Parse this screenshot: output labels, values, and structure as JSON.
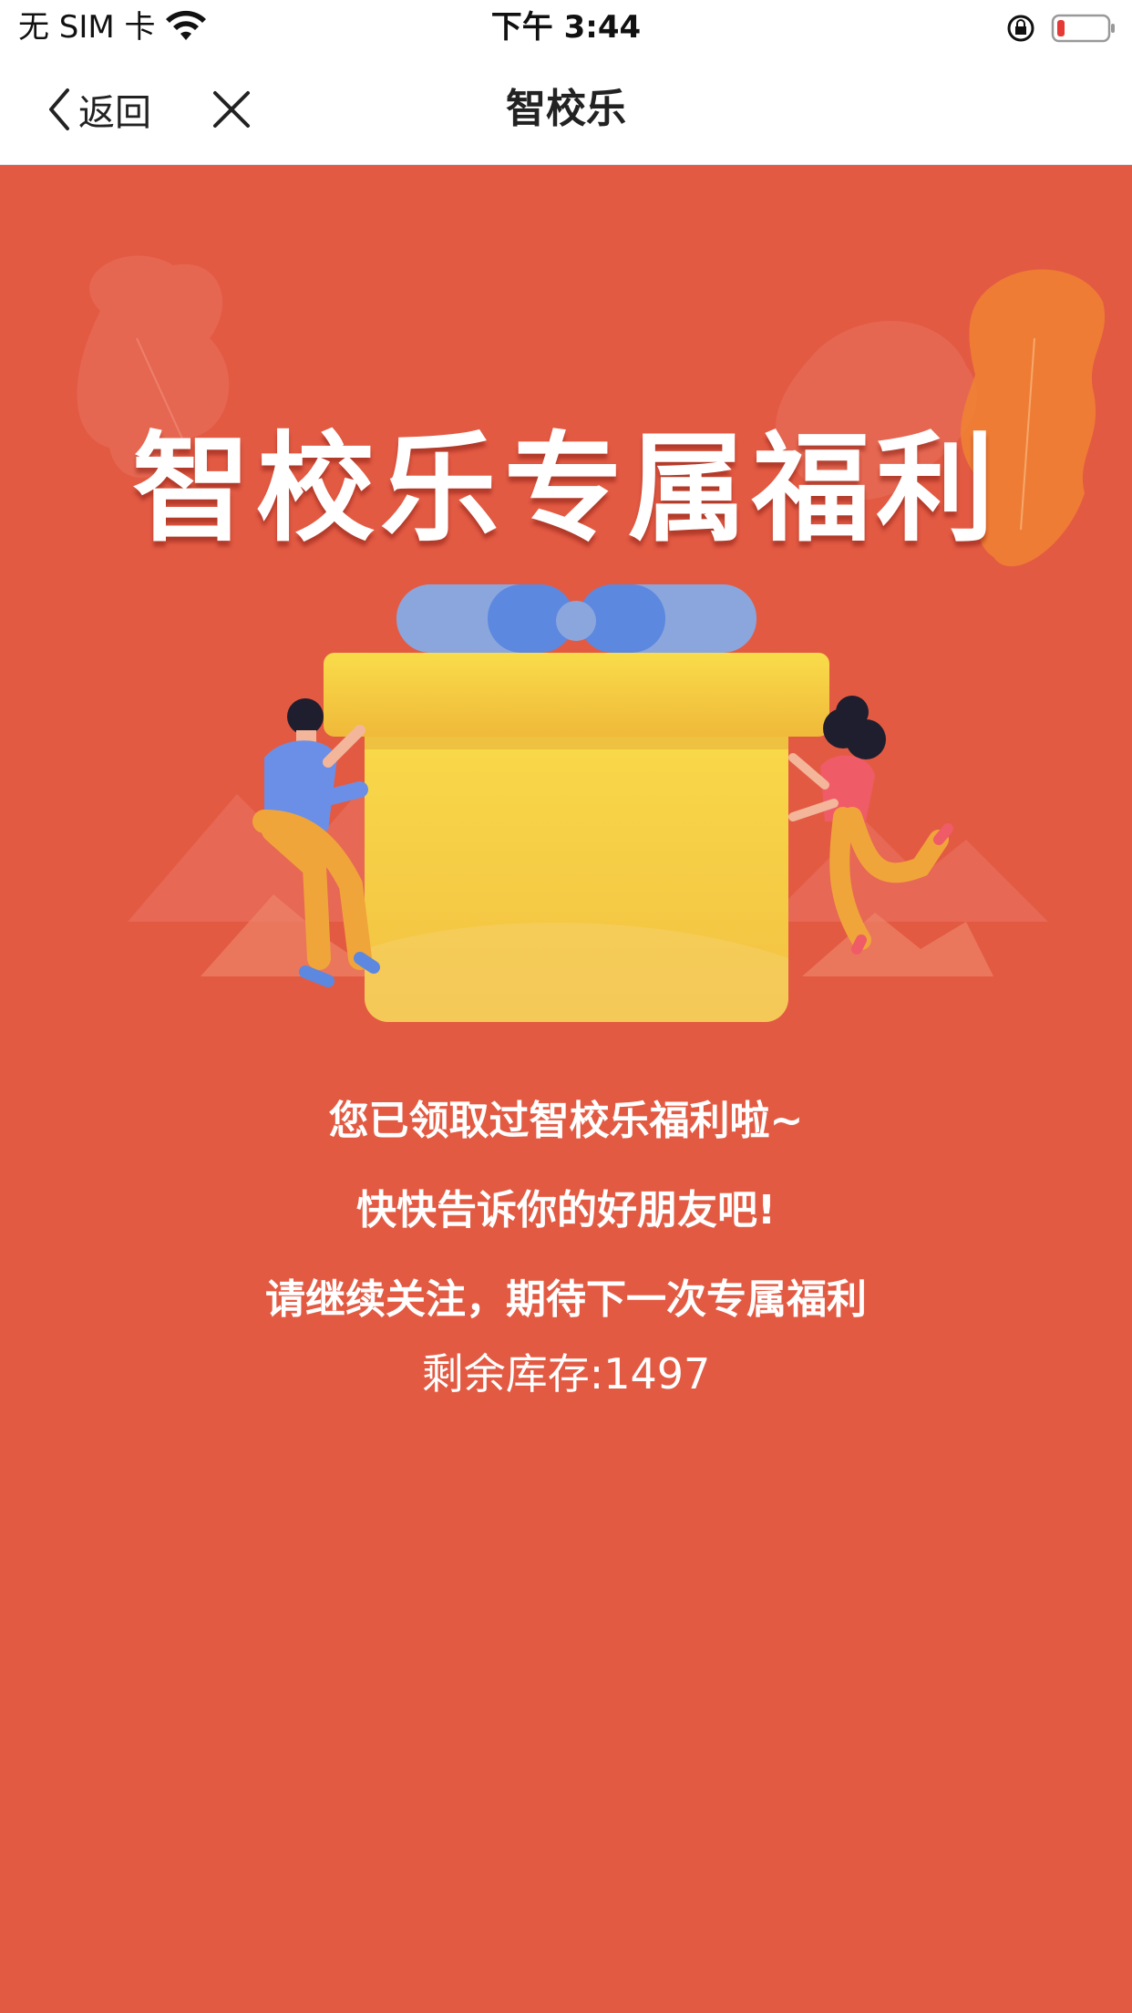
{
  "status_bar": {
    "carrier": "无 SIM 卡",
    "time": "下午 3:44",
    "icons": [
      "wifi-icon",
      "orientation-lock-icon",
      "battery-icon"
    ],
    "battery_color": "#e53935"
  },
  "nav": {
    "back_label": "返回",
    "title": "智校乐",
    "icons": [
      "chevron-left-icon",
      "close-icon"
    ]
  },
  "hero": {
    "title": "智校乐专属福利",
    "background_color": "#e35a43"
  },
  "messages": {
    "line1": "您已领取过智校乐福利啦~",
    "line2": "快快告诉你的好朋友吧!",
    "line3": "请继续关注，期待下一次专属福利",
    "stock": "剩余库存:1497"
  }
}
